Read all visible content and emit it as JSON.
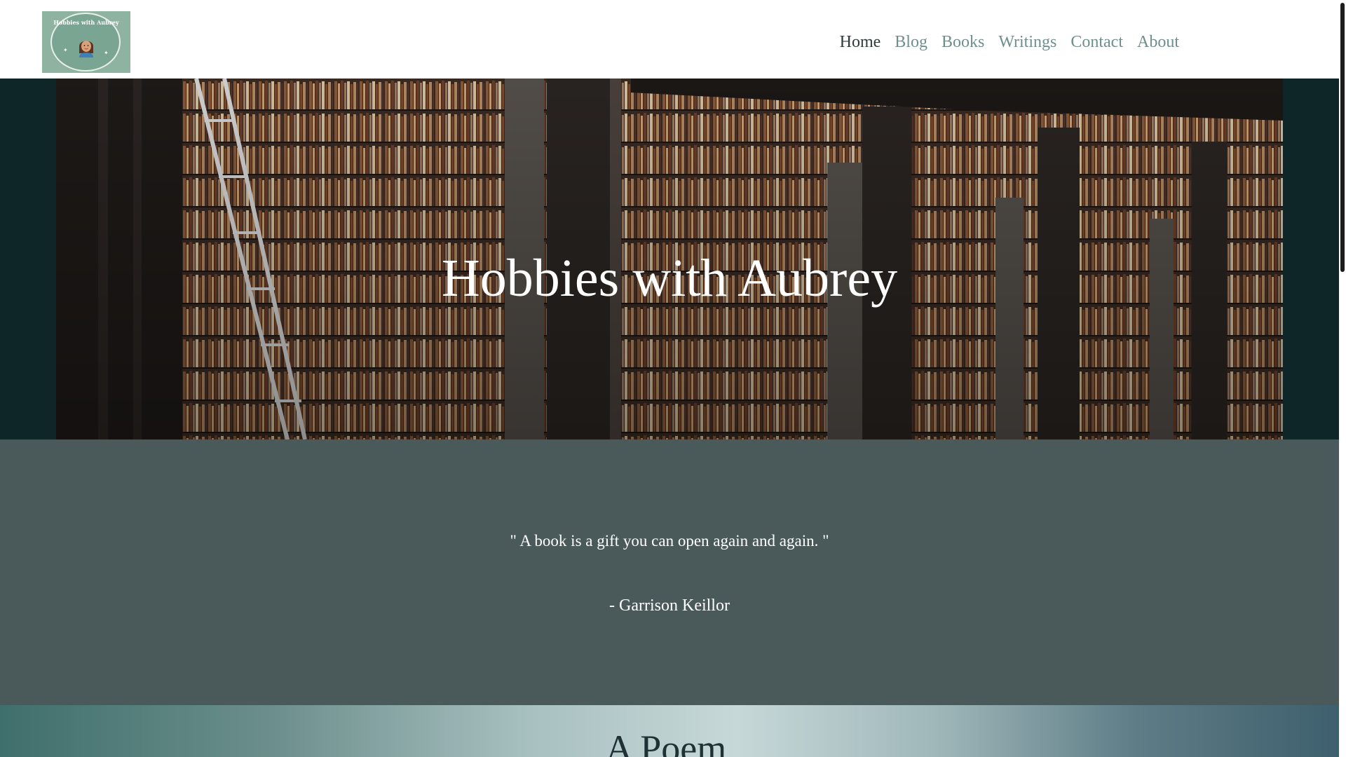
{
  "header": {
    "logo": {
      "text": "Hobbies with Aubrey"
    },
    "nav": [
      {
        "label": "Home",
        "active": true
      },
      {
        "label": "Blog",
        "active": false
      },
      {
        "label": "Books",
        "active": false
      },
      {
        "label": "Writings",
        "active": false
      },
      {
        "label": "Contact",
        "active": false
      },
      {
        "label": "About",
        "active": false
      }
    ]
  },
  "hero": {
    "title": "Hobbies with Aubrey",
    "background_icon": "library-bookshelves-image"
  },
  "quote": {
    "text": "\" A book is a gift you can open again and again. \"",
    "author": "- Garrison Keillor"
  },
  "poem": {
    "title": "A Poem"
  },
  "colors": {
    "nav_active": "#2e3a3a",
    "nav_inactive": "#6f8f8c",
    "quote_bg": "#4a5a5a",
    "hero_bg": "#0e2628"
  }
}
